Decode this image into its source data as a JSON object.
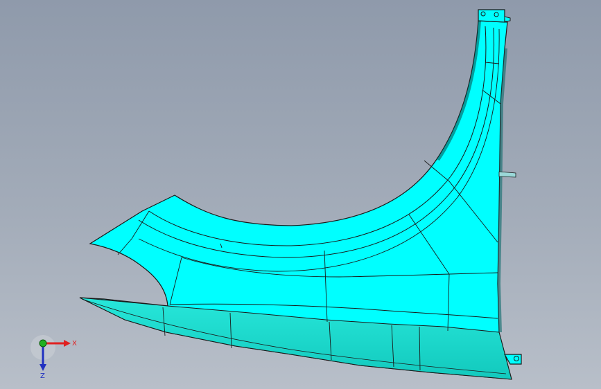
{
  "viewport": {
    "background_top": "#8f9aab",
    "background_bottom": "#b8bfc9"
  },
  "model": {
    "part": "front-fender-surface",
    "face_color": "#00ffff",
    "lower_flange_color": "#1fe3d6",
    "edge_color": "#1a1a1a"
  },
  "triad": {
    "x_label": "X",
    "z_label": "Z",
    "x_color": "#e02020",
    "y_color": "#20b020",
    "z_color": "#2030c0"
  }
}
